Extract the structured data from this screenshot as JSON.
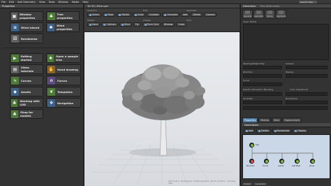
{
  "menubar": {
    "items": [
      "File",
      "Edit",
      "Add Geometry",
      "View",
      "Tools",
      "Window",
      "Media",
      "Help"
    ],
    "search_help": "Search Help"
  },
  "left_panel": {
    "title": "Properties",
    "tools": [
      {
        "label": "Window properties",
        "icon": "window-icon"
      },
      {
        "label": "Tree properties",
        "icon": "tree-icon"
      },
      {
        "label": "Wind wizard",
        "icon": "wind-icon"
      },
      {
        "label": "Wind properties",
        "icon": "wind-props-icon"
      },
      {
        "label": "Randomize",
        "icon": "dice-icon"
      }
    ],
    "learn": [
      {
        "label": "Getting started",
        "icon": "getting-started-icon"
      },
      {
        "label": "Open a sample tree",
        "icon": "sample-tree-icon"
      },
      {
        "label": "Video tutorials",
        "icon": "video-icon"
      },
      {
        "label": "Hand drawing",
        "icon": "hand-icon"
      },
      {
        "label": "Curves",
        "icon": "curves-icon"
      },
      {
        "label": "Forces",
        "icon": "magnet-icon"
      },
      {
        "label": "Assets",
        "icon": "assets-icon"
      },
      {
        "label": "Templates",
        "icon": "templates-icon"
      },
      {
        "label": "Working with LOD",
        "icon": "lod-icon"
      },
      {
        "label": "Navigation",
        "icon": "navigation-icon"
      },
      {
        "label": "Shop for models",
        "icon": "shop-icon"
      }
    ]
  },
  "viewport": {
    "title": "3D-3D | Beta.spm",
    "toolbar": {
      "row1": [
        "Select",
        "Move",
        "Rotate",
        "Scale",
        "Unrotate",
        "Generate",
        "Add",
        "Delete",
        "Camera"
      ],
      "row2": [
        "Hand",
        "Collision",
        "Wind",
        "Tip",
        "Pinch Grid",
        "Window",
        "Undo"
      ],
      "group_labels": [
        "Selection",
        "Edit",
        "Generate",
        "Weight",
        "Display",
        "Field"
      ]
    },
    "status": "LOD Level 0 - 89 Polygons - Fit Bounding Box - 99.5% of 0.8ms - 174 Draw Calls"
  },
  "right_panel": {
    "title": "Generator",
    "title_value": "Tree (Branches)",
    "tabs": [
      "General",
      "Geometry",
      "Spine",
      "Segments"
    ],
    "labels": [
      "Layer: Billow",
      "Skewing/Height Map",
      "Direction",
      "Curve",
      "Camper",
      "Biasing",
      "Search intersection Blending",
      "Color Adjustment",
      "Scramble",
      "Randomize"
    ],
    "lower_tabs": [
      "Properties",
      "Meshes",
      "Wind",
      "Displacement"
    ],
    "generators_title": "Generators",
    "generator_buttons": [
      "Add",
      "Delete",
      "Randomize",
      "Display"
    ],
    "nodes": [
      "Tree",
      "Branches",
      "Fronds",
      "Leaves",
      "Leaf Mesh",
      "Zones"
    ],
    "bottom_tabs": [
      "Output",
      "Generator"
    ]
  },
  "colors": {
    "accent": "#4f7fa8",
    "panel": "#333333",
    "viewport_bg": "#e5e8ec",
    "node_active": "#7fbf3f"
  }
}
